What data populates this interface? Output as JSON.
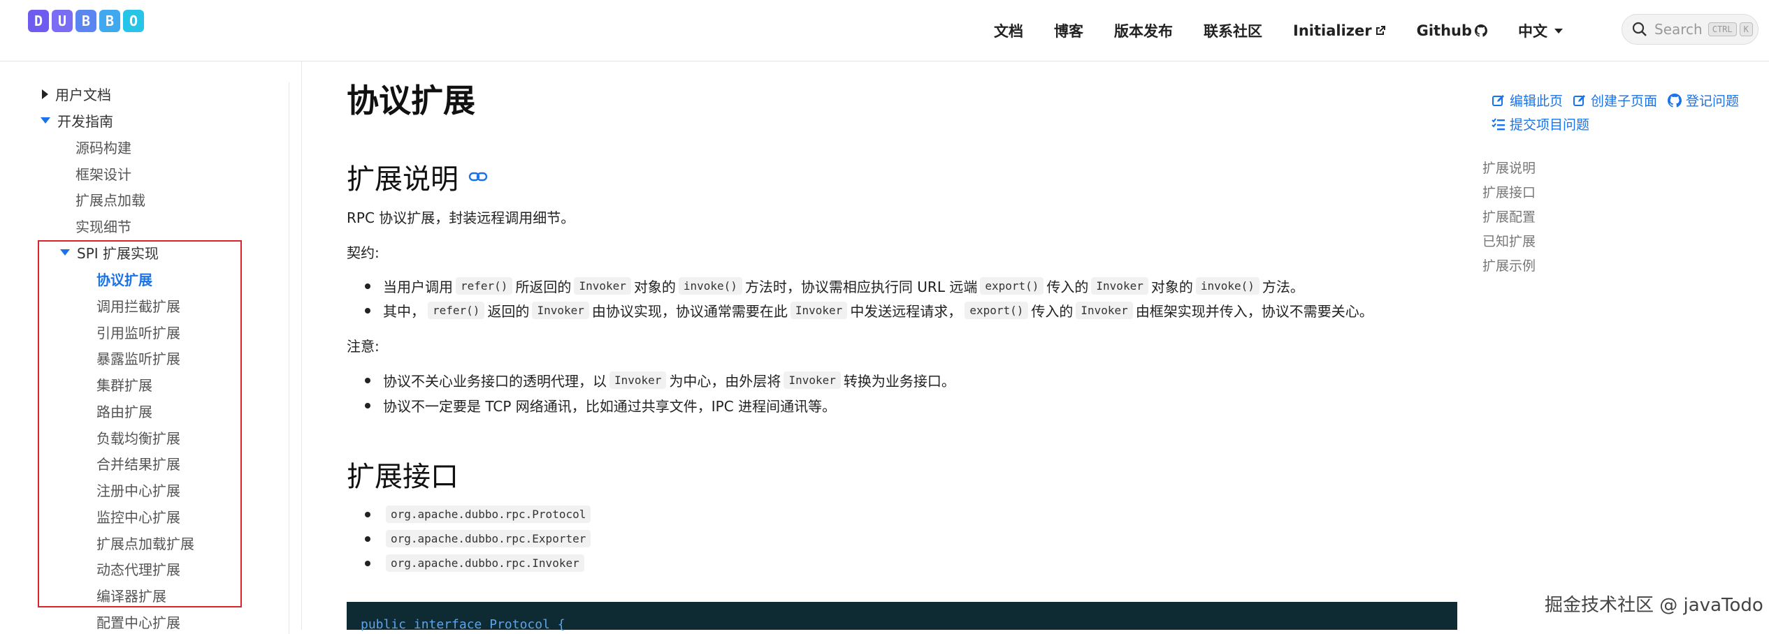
{
  "brand": {
    "letters": [
      "D",
      "U",
      "B",
      "B",
      "O"
    ],
    "colors": [
      "#6e5cf0",
      "#7a6cf3",
      "#5a86f2",
      "#3fa8ee",
      "#26c5e8"
    ]
  },
  "nav": [
    "文档",
    "博客",
    "版本发布",
    "联系社区",
    "Initializer",
    "Github",
    "中文"
  ],
  "search": {
    "placeholder": "Search",
    "kbd_ctrl": "CTRL",
    "kbd_k": "K"
  },
  "sidebar": {
    "user_docs": "用户文档",
    "dev_guide": "开发指南",
    "dev_items": [
      "源码构建",
      "框架设计",
      "扩展点加载",
      "实现细节"
    ],
    "spi": "SPI 扩展实现",
    "spi_items": [
      "协议扩展",
      "调用拦截扩展",
      "引用监听扩展",
      "暴露监听扩展",
      "集群扩展",
      "路由扩展",
      "负载均衡扩展",
      "合并结果扩展",
      "注册中心扩展",
      "监控中心扩展",
      "扩展点加载扩展",
      "动态代理扩展",
      "编译器扩展",
      "配置中心扩展"
    ]
  },
  "content": {
    "title": "协议扩展",
    "h2_desc": "扩展说明",
    "desc": "RPC 协议扩展，封装远程调用细节。",
    "contract_label": "契约:",
    "contract_items": [
      [
        "当用户调用 ",
        "refer()",
        " 所返回的 ",
        "Invoker",
        " 对象的 ",
        "invoke()",
        " 方法时，协议需相应执行同 URL 远端 ",
        "export()",
        " 传入的 ",
        "Invoker",
        " 对象的 ",
        "invoke()",
        " 方法。"
      ],
      [
        "其中，",
        "refer()",
        " 返回的 ",
        "Invoker",
        " 由协议实现，协议通常需要在此 ",
        "Invoker",
        " 中发送远程请求，",
        "export()",
        " 传入的 ",
        "Invoker",
        " 由框架实现并传入，协议不需要关心。"
      ]
    ],
    "note_label": "注意:",
    "note_items": [
      [
        "协议不关心业务接口的透明代理，以 ",
        "Invoker",
        " 为中心，由外层将 ",
        "Invoker",
        " 转换为业务接口。"
      ],
      [
        "协议不一定要是 TCP 网络通讯，比如通过共享文件，IPC 进程间通讯等。"
      ]
    ],
    "h2_iface": "扩展接口",
    "iface_items": [
      "org.apache.dubbo.rpc.Protocol",
      "org.apache.dubbo.rpc.Exporter",
      "org.apache.dubbo.rpc.Invoker"
    ],
    "code_line": "public interface Protocol {"
  },
  "actions": [
    "编辑此页",
    "创建子页面",
    "登记问题",
    "提交项目问题"
  ],
  "toc": [
    "扩展说明",
    "扩展接口",
    "扩展配置",
    "已知扩展",
    "扩展示例"
  ],
  "watermark": "掘金技术社区 @ javaTodo",
  "colors": {
    "link": "#1a73e8",
    "highlight_box": "#d9242b",
    "code_bg": "#0e2a33"
  }
}
